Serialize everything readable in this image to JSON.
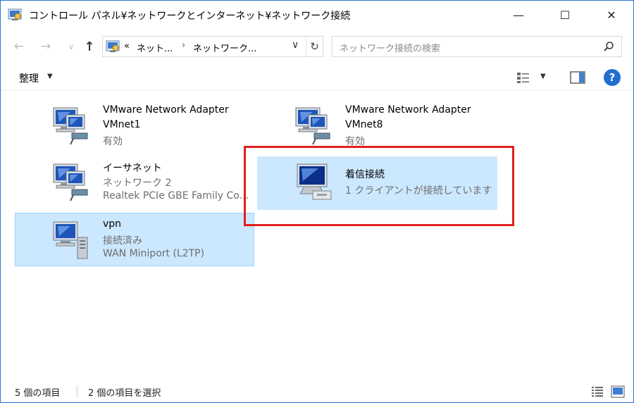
{
  "window": {
    "title": "コントロール パネル¥ネットワークとインターネット¥ネットワーク接続",
    "minimize": "—",
    "maximize": "☐",
    "close": "✕"
  },
  "nav": {
    "back": "←",
    "forward": "→",
    "recent": "∨",
    "up": "↑"
  },
  "address": {
    "overflow": "«",
    "crumbs": [
      "ネット...",
      "ネットワーク..."
    ],
    "separator": "›",
    "dropdown": "∨",
    "refresh": "↻"
  },
  "search": {
    "placeholder": "ネットワーク接続の検索"
  },
  "toolbar": {
    "organize": "整理",
    "caret": "▼",
    "help": "?"
  },
  "items": [
    {
      "name": "VMware Network Adapter",
      "line2": "VMnet1",
      "line3": "有効",
      "selected": false
    },
    {
      "name": "VMware Network Adapter",
      "line2": "VMnet8",
      "line3": "有効",
      "selected": false
    },
    {
      "name": "イーサネット",
      "line2": "ネットワーク 2",
      "line3": "Realtek PCIe GBE Family Co...",
      "selected": false
    },
    {
      "name": "着信接続",
      "line2": "1 クライアントが接続しています",
      "line3": "",
      "selected": true
    },
    {
      "name": "vpn",
      "line2": "接続済み",
      "line3": "WAN Miniport (L2TP)",
      "selected": true
    }
  ],
  "status": {
    "count": "5 個の項目",
    "selected": "2 個の項目を選択"
  },
  "colors": {
    "accent": "#2b78d6",
    "selection": "#cce8ff",
    "selection_border": "#99d1ff",
    "highlight": "#e0201e"
  }
}
